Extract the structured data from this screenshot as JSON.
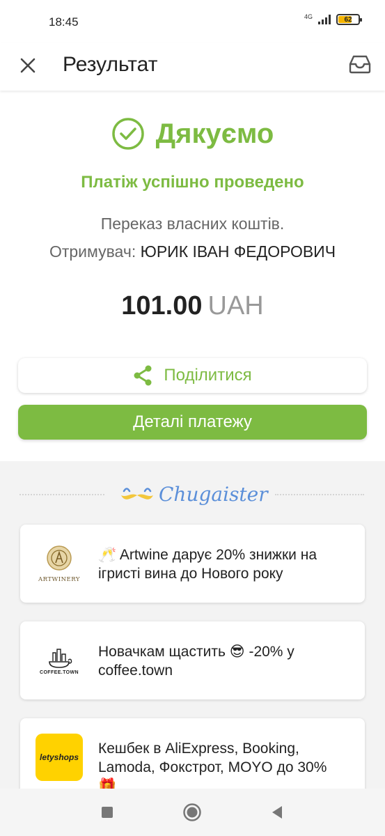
{
  "status_bar": {
    "time": "18:45",
    "network": "4G",
    "battery_level": "62"
  },
  "app_bar": {
    "title": "Результат",
    "close_icon": "close-icon",
    "inbox_icon": "inbox-icon"
  },
  "result": {
    "heading": "Дякуємо",
    "status": "Платіж успішно проведено",
    "description": "Переказ власних коштів.",
    "recipient_label": "Отримувач:",
    "recipient_name": "ЮРИК ІВАН ФЕДОРОВИЧ",
    "amount": "101.00",
    "currency": "UAH"
  },
  "actions": {
    "share_label": "Поділитися",
    "details_label": "Деталі платежу"
  },
  "promo": {
    "brand": "Chugaister",
    "offers": [
      {
        "logo_text": "ARTWINERY",
        "text": "🥂 Artwine дарує 20% знижки на ігристі вина до Нового року"
      },
      {
        "logo_text": "COFFEE.TOWN",
        "text": "Новачкам щастить 😎 -20% у coffee.town"
      },
      {
        "logo_text": "letyshops",
        "text": "Кешбек в AliExpress, Booking, Lamoda, Фокстрот, MOYO до 30% 🎁"
      }
    ]
  },
  "colors": {
    "accent": "#7dbb42",
    "brand_blue": "#5b8fd9",
    "background_promo": "#f3f3f3",
    "lety_yellow": "#ffd200"
  }
}
